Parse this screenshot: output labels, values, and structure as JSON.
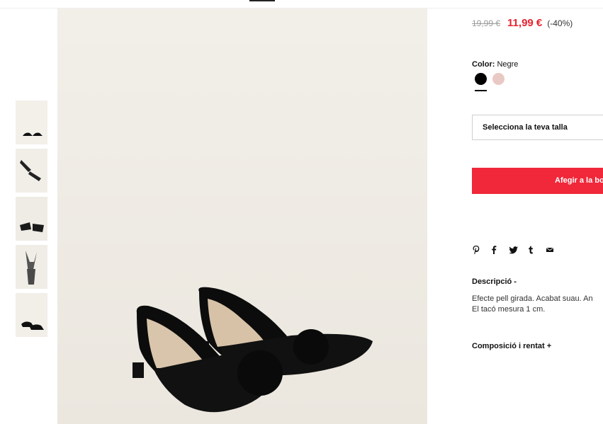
{
  "gallery": {
    "thumbnails": [
      "thumb-1",
      "thumb-2",
      "thumb-3",
      "thumb-4",
      "thumb-5"
    ]
  },
  "product": {
    "price_old": "19,99 €",
    "price_new": "11,99 €",
    "discount": "(-40%)",
    "color_label": "Color:",
    "color_value": "Negre",
    "colors": [
      "#000000",
      "#e9c9c3"
    ],
    "size_placeholder": "Selecciona la teva talla",
    "add_button": "Afegir a la bo"
  },
  "share": {
    "icons": [
      "pinterest-icon",
      "facebook-icon",
      "twitter-icon",
      "tumblr-icon",
      "email-icon"
    ]
  },
  "description": {
    "title": "Descripció  -",
    "line1": "Efecte pell girada. Acabat suau. An",
    "line2": "El tacó mesura 1 cm."
  },
  "composition": {
    "title": "Composició i rentat  +"
  }
}
